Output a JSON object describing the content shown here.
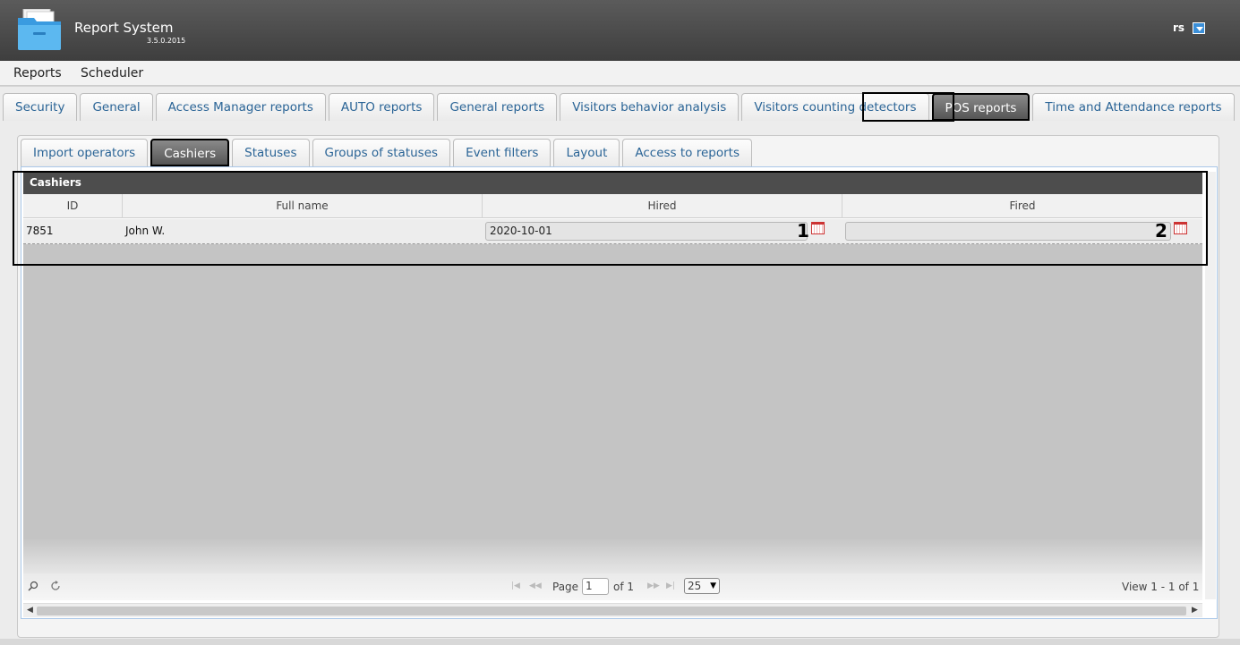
{
  "header": {
    "title": "Report System",
    "version": "3.5.0.2015",
    "user": "rs"
  },
  "menu": {
    "items": [
      "Reports",
      "Scheduler"
    ]
  },
  "top_tabs": [
    "Security",
    "General",
    "Access Manager reports",
    "AUTO reports",
    "General reports",
    "Visitors behavior analysis",
    "Visitors counting detectors",
    "POS reports",
    "Time and Attendance reports"
  ],
  "top_tabs_active": "POS reports",
  "sub_tabs": [
    "Import operators",
    "Cashiers",
    "Statuses",
    "Groups of statuses",
    "Event filters",
    "Layout",
    "Access to reports"
  ],
  "sub_tabs_active": "Cashiers",
  "grid": {
    "title": "Cashiers",
    "columns": [
      "ID",
      "Full name",
      "Hired",
      "Fired"
    ],
    "rows": [
      {
        "id": "7851",
        "full_name": "John W.",
        "hired": "2020-10-01",
        "fired": ""
      }
    ]
  },
  "callouts": {
    "first": "1",
    "second": "2"
  },
  "pager": {
    "page_label": "Page",
    "page": "1",
    "of_label": "of 1",
    "rows_per_page": "25",
    "view_text": "View 1 - 1 of 1"
  },
  "icons": [
    "folder-logo-icon",
    "dropdown-arrow-icon",
    "calendar-icon",
    "search-icon",
    "refresh-icon",
    "first-page-icon",
    "prev-page-icon",
    "next-page-icon",
    "last-page-icon"
  ]
}
